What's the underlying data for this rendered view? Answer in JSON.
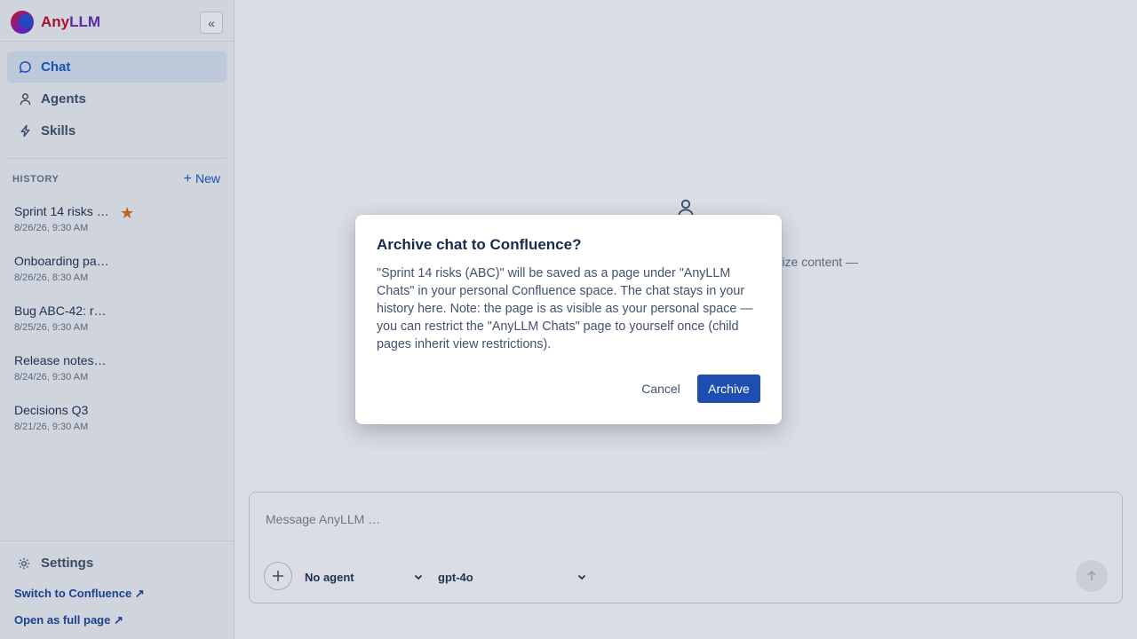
{
  "app": {
    "brand_prefix": "Any",
    "brand_suffix": "LLM",
    "collapse_label": "«"
  },
  "nav": [
    {
      "label": "Chat",
      "icon": "chat-bubble-icon",
      "active": true
    },
    {
      "label": "Agents",
      "icon": "person-icon",
      "active": false
    },
    {
      "label": "Skills",
      "icon": "bolt-icon",
      "active": false
    }
  ],
  "history": {
    "label": "HISTORY",
    "new_label": "New",
    "items": [
      {
        "title": "Sprint 14 risks …",
        "date": "8/26/26, 9:30 AM",
        "starred": true
      },
      {
        "title": "Onboarding pa…",
        "date": "8/26/26, 8:30 AM",
        "starred": false
      },
      {
        "title": "Bug ABC-42: r…",
        "date": "8/25/26, 9:30 AM",
        "starred": false
      },
      {
        "title": "Release notes…",
        "date": "8/24/26, 9:30 AM",
        "starred": false
      },
      {
        "title": "Decisions Q3",
        "date": "8/21/26, 9:30 AM",
        "starred": false
      }
    ]
  },
  "footer": {
    "settings_label": "Settings",
    "switch_link": "Switch to Confluence ↗",
    "open_link": "Open as full page ↗"
  },
  "main": {
    "background_text": "arize content —"
  },
  "composer": {
    "placeholder": "Message AnyLLM …",
    "agent_select": "No agent",
    "model_select": "gpt-4o"
  },
  "modal": {
    "title": "Archive chat to Confluence?",
    "body": "\"Sprint 14 risks (ABC)\" will be saved as a page under \"AnyLLM Chats\" in your personal Confluence space. The chat stays in your history here. Note: the page is as visible as your personal space — you can restrict the \"AnyLLM Chats\" page to yourself once (child pages inherit view restrictions).",
    "cancel_label": "Cancel",
    "archive_label": "Archive"
  },
  "colors": {
    "accent": "#1d5bc6",
    "primary_button": "#1e4fb0",
    "star": "#d9731c",
    "brand_red": "#c8102e"
  }
}
